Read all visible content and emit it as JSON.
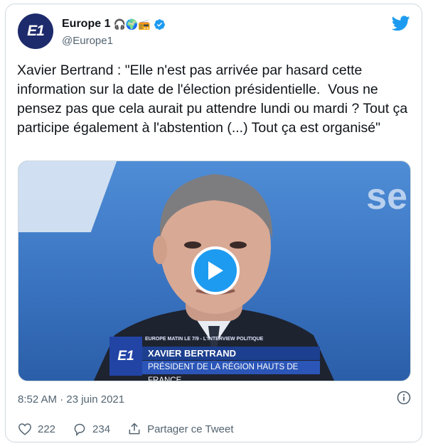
{
  "account": {
    "display_name": "Europe 1",
    "handle": "@Europe1",
    "avatar_text": "E1",
    "name_emojis": "🎧🌍📻"
  },
  "tweet": {
    "text": "Xavier Bertrand : \"Elle n'est pas arrivée par hasard cette information sur la date de l'élection présidentielle.  Vous ne pensez pas que cela aurait pu attendre lundi ou mardi ? Tout ça participe également à l'abstention (...) Tout ça est organisé\"",
    "timestamp": "8:52 AM · 23 juin 2021"
  },
  "video": {
    "bg_text": "se",
    "logo": "E1",
    "show_line": "EUROPE MATIN LE 7/9 - L'INTERVIEW POLITIQUE",
    "guest_name": "XAVIER BERTRAND",
    "guest_title": "PRÉSIDENT DE LA RÉGION HAUTS DE FRANCE"
  },
  "actions": {
    "likes": "222",
    "replies": "234",
    "share_label": "Partager ce Tweet"
  },
  "colors": {
    "brand_blue": "#1d9bf0",
    "avatar_navy": "#1d2a6b",
    "muted": "#536471"
  },
  "icons": [
    "twitter-bird-icon",
    "verified-badge-icon",
    "play-icon",
    "info-icon",
    "heart-icon",
    "reply-icon",
    "share-icon"
  ]
}
